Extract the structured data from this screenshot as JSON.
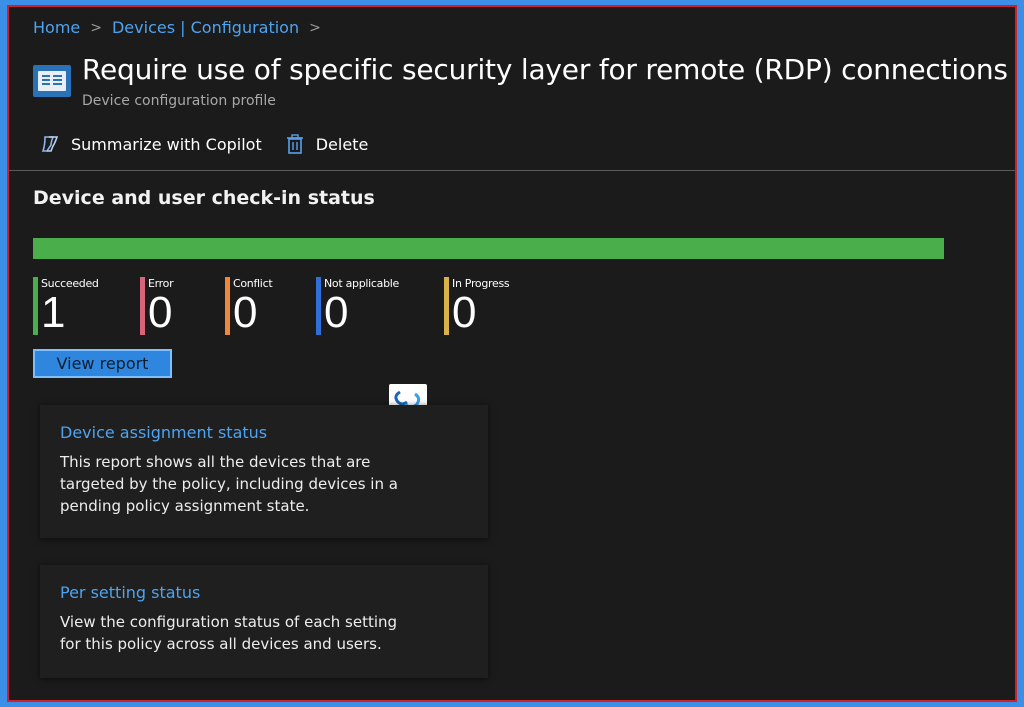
{
  "breadcrumb": {
    "items": [
      "Home",
      "Devices | Configuration"
    ],
    "separator": ">"
  },
  "header": {
    "title": "Require use of specific security layer for remote (RDP) connections",
    "subtitle": "Device configuration profile",
    "icon": "configuration-profile-icon"
  },
  "toolbar": {
    "copilot_label": "Summarize with Copilot",
    "copilot_icon": "copilot-icon",
    "delete_label": "Delete",
    "delete_icon": "trash-icon"
  },
  "checkin": {
    "title": "Device and user check-in status",
    "progress_succeeded_fraction": 1.0,
    "progress_color": "#4aaf4a",
    "stats": [
      {
        "label": "Succeeded",
        "value": "1",
        "color": "#4aaf4a"
      },
      {
        "label": "Error",
        "value": "0",
        "color": "#d9637a"
      },
      {
        "label": "Conflict",
        "value": "0",
        "color": "#f0883a"
      },
      {
        "label": "Not applicable",
        "value": "0",
        "color": "#2f6fd8"
      },
      {
        "label": "In Progress",
        "value": "0",
        "color": "#d9b34a"
      }
    ],
    "view_report_label": "View report"
  },
  "cards": [
    {
      "title": "Device assignment status",
      "lines": [
        "This report shows all the devices that are",
        "targeted by the policy, including devices in a",
        "pending policy assignment state."
      ]
    },
    {
      "title": "Per setting status",
      "lines": [
        "View the configuration status of each setting",
        "for this policy across all devices and users."
      ]
    }
  ],
  "colors": {
    "accent_link": "#4ea3f0",
    "background": "#1b1b1b",
    "frame_border": "#d0202c",
    "outer_background": "#3b8fe6"
  }
}
